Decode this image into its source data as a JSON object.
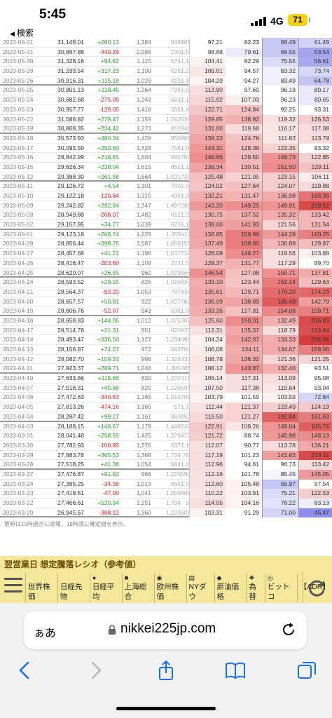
{
  "status_bar": {
    "time": "5:45",
    "back_label": "検索",
    "network": "4G",
    "battery": "71"
  },
  "rows": [
    {
      "date": "2023-06-01",
      "close": "31,148.01",
      "change": "+260.13",
      "up": "1,384",
      "down": "948",
      "unch": "805",
      "r1": "97.21",
      "r2": "82.23",
      "r3": "66.49",
      "r4": "61.49",
      "c1": "#ffffff",
      "c2": "#ffffff",
      "c3": "#c8c8f5",
      "c4": "#d2d2f8",
      "week": false
    },
    {
      "date": "2023-05-31",
      "close": "30,887.88",
      "change": "-440.28",
      "up": "2,586",
      "down": "230",
      "unch": "1,571",
      "r1": "98.88",
      "r2": "79.61",
      "r3": "66.55",
      "r4": "53.54",
      "c1": "#ffffff",
      "c2": "#ececfc",
      "c3": "#c8c8f5",
      "c4": "#a4a4ee",
      "week": false
    },
    {
      "date": "2023-05-30",
      "close": "31,328.16",
      "change": "+94.62",
      "up": "1,115",
      "down": "574",
      "unch": "1,197",
      "r1": "104.41",
      "r2": "82.29",
      "r3": "75.55",
      "r4": "56.61",
      "c1": "#fdf1f1",
      "c2": "#ffffff",
      "c3": "#dcdcfa",
      "c4": "#a9a9ef",
      "week": false
    },
    {
      "date": "2023-05-29",
      "close": "31,233.54",
      "change": "+317.23",
      "up": "1,109",
      "down": "626",
      "unch": "1,291",
      "r1": "109.01",
      "r2": "94.57",
      "r3": "83.32",
      "r4": "73.74",
      "c1": "#fbe6e6",
      "c2": "#ffffff",
      "c3": "#f0f0fd",
      "c4": "#d8d8f8",
      "week": false
    },
    {
      "date": "2023-05-26",
      "close": "30,916.31",
      "change": "+115.18",
      "up": "1,029",
      "down": "419",
      "unch": "1,171",
      "r1": "104.29",
      "r2": "94.27",
      "r3": "83.49",
      "r4": "64.78",
      "c1": "#fdf1f1",
      "c2": "#ffffff",
      "c3": "#f0f0fd",
      "c4": "#c4c4f4",
      "week": true
    },
    {
      "date": "2023-05-25",
      "close": "30,801.13",
      "change": "+118.45",
      "up": "1,264",
      "down": "726",
      "unch": "1,010",
      "r1": "113.90",
      "r2": "97.60",
      "r3": "96.19",
      "r4": "80.17",
      "c1": "#fadcdc",
      "c2": "#ffffff",
      "c3": "#ffffff",
      "c4": "#eaeafc",
      "week": false
    },
    {
      "date": "2023-05-24",
      "close": "30,682.68",
      "change": "-275.09",
      "up": "1,243",
      "down": "603",
      "unch": "1,134",
      "r1": "115.92",
      "r2": "107.03",
      "r3": "96.23",
      "r4": "80.65",
      "c1": "#f9d6d6",
      "c2": "#fcecec",
      "c3": "#ffffff",
      "c4": "#eaeafc",
      "week": false
    },
    {
      "date": "2023-05-23",
      "close": "30,957.77",
      "change": "-129.05",
      "up": "1,418",
      "down": "356",
      "unch": "1,420",
      "r1": "122.71",
      "r2": "124.84",
      "r3": "92.25",
      "r4": "93.31",
      "c1": "#f6c6c6",
      "c2": "#f5c2c2",
      "c3": "#ffffff",
      "c4": "#ffffff",
      "week": false
    },
    {
      "date": "2023-05-22",
      "close": "31,086.82",
      "change": "+278.47",
      "up": "1,159",
      "down": "1,242",
      "unch": "539",
      "r1": "129.85",
      "r2": "138.92",
      "r3": "119.32",
      "r4": "126.53",
      "c1": "#f3b5b5",
      "c2": "#f2b0b0",
      "c3": "#fae0e0",
      "c4": "#f7cccc",
      "week": false
    },
    {
      "date": "2023-05-19",
      "close": "30,808.35",
      "change": "+234.42",
      "up": "1,273",
      "down": "812",
      "unch": "945",
      "r1": "131.00",
      "r2": "119.68",
      "r3": "116.17",
      "r4": "117.08",
      "c1": "#f3b2b2",
      "c2": "#f9dcdc",
      "c3": "#fae4e4",
      "c4": "#fadcdc",
      "week": true
    },
    {
      "date": "2023-05-18",
      "close": "30,573.93",
      "change": "+480.34",
      "up": "1,426",
      "down": "956",
      "unch": "808",
      "r1": "138.22",
      "r2": "124.76",
      "r3": "111.83",
      "r4": "113.79",
      "c1": "#f0a5a5",
      "c2": "#f5c2c2",
      "c3": "#fbe6e6",
      "c4": "#fadcdc",
      "week": false
    },
    {
      "date": "2023-05-17",
      "close": "30,093.59",
      "change": "+250.60",
      "up": "1,428",
      "down": "758",
      "unch": "1,007",
      "r1": "143.31",
      "r2": "128.39",
      "r3": "122.35",
      "r4": "93.32",
      "c1": "#ee9898",
      "c2": "#f4bcbc",
      "c3": "#f7d0d0",
      "c4": "#ffffff",
      "week": false
    },
    {
      "date": "2023-05-16",
      "close": "29,842.99",
      "change": "+216.65",
      "up": "1,604",
      "down": "995",
      "unch": "767",
      "r1": "148.86",
      "r2": "129.50",
      "r3": "149.73",
      "r4": "122.85",
      "c1": "#ec8c8c",
      "c2": "#f4b8b8",
      "c3": "#ee9292",
      "c4": "#f7d0d0",
      "week": false
    },
    {
      "date": "2023-05-15",
      "close": "29,626.34",
      "change": "+238.04",
      "up": "1,615",
      "down": "855",
      "unch": "1,175",
      "r1": "139.34",
      "r2": "130.51",
      "r3": "151.50",
      "r4": "129.11",
      "c1": "#f0a2a2",
      "c2": "#f4b6b6",
      "c3": "#ec8c8c",
      "c4": "#f5c0c0",
      "week": false
    },
    {
      "date": "2023-05-12",
      "close": "29,388.30",
      "change": "+261.58",
      "up": "1,664",
      "down": "1,031",
      "unch": "737",
      "r1": "125.48",
      "r2": "121.05",
      "r3": "123.15",
      "r4": "106.11",
      "c1": "#f5c0c0",
      "c2": "#f8d2d2",
      "c3": "#f7cece",
      "c4": "#fcecec",
      "week": true
    },
    {
      "date": "2023-05-11",
      "close": "29,126.72",
      "change": "+4.54",
      "up": "1,301",
      "down": "740",
      "unch": "1,021",
      "r1": "124.02",
      "r2": "127.64",
      "r3": "124.07",
      "r4": "119.88",
      "c1": "#f6c4c4",
      "c2": "#f5c0c0",
      "c3": "#f7cccc",
      "c4": "#f9dada",
      "week": false
    },
    {
      "date": "2023-05-10",
      "close": "29,122.18",
      "change": "-120.64",
      "up": "1,315",
      "down": "436",
      "unch": "1,341",
      "r1": "132.21",
      "r2": "131.47",
      "r3": "136.98",
      "r4": "169.39",
      "c1": "#f2adad",
      "c2": "#f4b4b4",
      "c3": "#f2acac",
      "c4": "#e67373",
      "week": false
    },
    {
      "date": "2023-05-09",
      "close": "29,242.82",
      "change": "+292.94",
      "up": "1,347",
      "down": "1,497",
      "unch": "288",
      "r1": "143.20",
      "r2": "149.25",
      "r3": "149.91",
      "r4": "219.52",
      "c1": "#ee9898",
      "c2": "#ec8e8e",
      "c3": "#ee9292",
      "c4": "#d94a4a",
      "week": false
    },
    {
      "date": "2023-05-08",
      "close": "28,949.88",
      "change": "-208.07",
      "up": "1,482",
      "down": "612",
      "unch": "1,276",
      "r1": "130.75",
      "r2": "137.52",
      "r3": "135.32",
      "r4": "133.42",
      "c1": "#f3b4b4",
      "c2": "#f2acac",
      "c3": "#f2acac",
      "c4": "#f4b6b6",
      "week": false
    },
    {
      "date": "2023-05-02",
      "close": "29,157.95",
      "change": "+34.77",
      "up": "1,039",
      "down": "623",
      "unch": "1,115",
      "r1": "138.00",
      "r2": "141.93",
      "r3": "121.56",
      "r4": "131.54",
      "c1": "#f0a6a6",
      "c2": "#ef9e9e",
      "c3": "#f8d4d4",
      "c4": "#f4b6b6",
      "week": true
    },
    {
      "date": "2023-05-01",
      "close": "29,123.18",
      "change": "+266.74",
      "up": "1,229",
      "down": "1,355",
      "unch": "417",
      "r1": "138.85",
      "r2": "159.99",
      "r3": "144.28",
      "r4": "160.25",
      "c1": "#f0a4a4",
      "c2": "#e97c7c",
      "c3": "#ef9a9a",
      "c4": "#e88080",
      "week": false
    },
    {
      "date": "2023-04-28",
      "close": "28,856.44",
      "change": "+398.76",
      "up": "1,587",
      "down": "1,659",
      "unch": "155",
      "r1": "137.49",
      "r2": "159.80",
      "r3": "130.89",
      "r4": "129.97",
      "c1": "#f0a8a8",
      "c2": "#e97c7c",
      "c3": "#f4b6b6",
      "c4": "#f5bebe",
      "week": false
    },
    {
      "date": "2023-04-27",
      "close": "28,457.68",
      "change": "+41.21",
      "up": "1,196",
      "down": "1,037",
      "unch": "712",
      "r1": "128.09",
      "r2": "148.27",
      "r3": "119.56",
      "r4": "103.89",
      "c1": "#f4baba",
      "c2": "#ec8e8e",
      "c3": "#f9dcdc",
      "c4": "#fdf1f1",
      "week": false
    },
    {
      "date": "2023-04-26",
      "close": "28,416.47",
      "change": "-203.60",
      "up": "1,109",
      "down": "273",
      "unch": "1,516",
      "r1": "128.37",
      "r2": "131.77",
      "r3": "117.29",
      "r4": "89.70",
      "c1": "#f4baba",
      "c2": "#f3b2b2",
      "c3": "#fadede",
      "c4": "#ffffff",
      "week": false
    },
    {
      "date": "2023-04-25",
      "close": "28,620.07",
      "change": "+26.55",
      "up": "962",
      "down": "1,079",
      "unch": "666",
      "r1": "146.54",
      "r2": "127.08",
      "r3": "150.71",
      "r4": "137.81",
      "c1": "#ec9090",
      "c2": "#f5c0c0",
      "c3": "#ee9090",
      "c4": "#f2aaaa",
      "week": true
    },
    {
      "date": "2023-04-24",
      "close": "28,593.52",
      "change": "+29.15",
      "up": "826",
      "down": "1,016",
      "unch": "834",
      "r1": "133.10",
      "r2": "123.44",
      "r3": "162.14",
      "r4": "129.63",
      "c1": "#f2acac",
      "c2": "#f6c6c6",
      "c3": "#e87a7a",
      "c4": "#f5bebe",
      "week": false
    },
    {
      "date": "2023-04-21",
      "close": "28,564.37",
      "change": "-93.20",
      "up": "1,053",
      "down": "797",
      "unch": "834",
      "r1": "135.61",
      "r2": "129.71",
      "r3": "170.20",
      "r4": "174.23",
      "c1": "#f1a8a8",
      "c2": "#f4b8b8",
      "c3": "#e56c6c",
      "c4": "#e46868",
      "week": false
    },
    {
      "date": "2023-04-20",
      "close": "28,657.57",
      "change": "+50.81",
      "up": "922",
      "down": "1,027",
      "unch": "702",
      "r1": "136.09",
      "r2": "138.89",
      "r3": "185.48",
      "r4": "142.79",
      "c1": "#f1a8a8",
      "c2": "#f0a4a4",
      "c3": "#e05c5c",
      "c4": "#ef9c9c",
      "week": false
    },
    {
      "date": "2023-04-19",
      "close": "28,606.76",
      "change": "-52.07",
      "up": "943",
      "down": "638",
      "unch": "1,081",
      "r1": "133.26",
      "r2": "127.81",
      "r3": "154.08",
      "r4": "159.71",
      "c1": "#f2acac",
      "c2": "#f5c0c0",
      "c3": "#ec8888",
      "c4": "#e88080",
      "week": true
    },
    {
      "date": "2023-04-18",
      "close": "28,658.83",
      "change": "+144.05",
      "up": "1,012",
      "down": "1,371",
      "unch": "387",
      "r1": "125.60",
      "r2": "150.31",
      "r3": "132.49",
      "r4": "216.83",
      "c1": "#f5c0c0",
      "c2": "#ec8c8c",
      "c3": "#f3b0b0",
      "c4": "#d94c4c",
      "week": false
    },
    {
      "date": "2023-04-17",
      "close": "28,514.78",
      "change": "+21.31",
      "up": "951",
      "down": "920",
      "unch": "820",
      "r1": "112.31",
      "r2": "135.37",
      "r3": "118.79",
      "r4": "213.84",
      "c1": "#fae0e0",
      "c2": "#f2a8a8",
      "c3": "#f9dcdc",
      "c4": "#da5050",
      "week": false
    },
    {
      "date": "2023-04-14",
      "close": "28,493.47",
      "change": "+336.50",
      "up": "1,127",
      "down": "1,234",
      "unch": "496",
      "r1": "104.24",
      "r2": "142.07",
      "r3": "133.33",
      "r4": "236.56",
      "c1": "#fdf1f1",
      "c2": "#ef9e9e",
      "c3": "#f2acac",
      "c4": "#d43e3e",
      "week": false
    },
    {
      "date": "2023-04-13",
      "close": "28,156.97",
      "change": "+74.27",
      "up": "972",
      "down": "943",
      "unch": "760",
      "r1": "106.08",
      "r2": "134.11",
      "r3": "134.67",
      "r4": "158.06",
      "c1": "#fcecec",
      "c2": "#f2acac",
      "c3": "#f2aaaa",
      "c4": "#e88080",
      "week": false
    },
    {
      "date": "2023-04-12",
      "close": "28,082.70",
      "change": "+159.33",
      "up": "998",
      "down": "1,324",
      "unch": "433",
      "r1": "108.78",
      "r2": "136.32",
      "r3": "121.36",
      "r4": "121.25",
      "c1": "#fbe6e6",
      "c2": "#f1a8a8",
      "c3": "#f8d4d4",
      "c4": "#f8d4d4",
      "week": false
    },
    {
      "date": "2023-04-11",
      "close": "27,923.37",
      "change": "+289.71",
      "up": "1,046",
      "down": "1,385",
      "unch": "365",
      "r1": "108.12",
      "r2": "143.87",
      "r3": "132.40",
      "r4": "93.51",
      "c1": "#fbe6e6",
      "c2": "#ee9696",
      "c3": "#f3b0b0",
      "c4": "#ffffff",
      "week": true
    },
    {
      "date": "2023-04-10",
      "close": "27,633.66",
      "change": "+115.66",
      "up": "820",
      "down": "1,332",
      "unch": "415",
      "r1": "106.14",
      "r2": "117.31",
      "r3": "113.09",
      "r4": "95.08",
      "c1": "#fcecec",
      "c2": "#fadede",
      "c3": "#fadede",
      "c4": "#ffffff",
      "week": false
    },
    {
      "date": "2023-04-07",
      "close": "27,518.31",
      "change": "+45.68",
      "up": "820",
      "down": "1,126",
      "unch": "595",
      "r1": "107.50",
      "r2": "117.38",
      "r3": "110.64",
      "r4": "93.04",
      "c1": "#fbe8e8",
      "c2": "#fadede",
      "c3": "#fbe6e6",
      "c4": "#ffffff",
      "week": false
    },
    {
      "date": "2023-04-06",
      "close": "27,472.63",
      "change": "-340.63",
      "up": "1,165",
      "down": "1,016",
      "unch": "760",
      "r1": "103.79",
      "r2": "101.59",
      "r3": "103.59",
      "r4": "72.84",
      "c1": "#fdf1f1",
      "c2": "#ffffff",
      "c3": "#fdf1f1",
      "c4": "#d6d6f8",
      "week": false
    },
    {
      "date": "2023-04-05",
      "close": "27,813.26",
      "change": "-474.16",
      "up": "1,165",
      "down": "57",
      "unch": "1,763",
      "r1": "111.44",
      "r2": "121.37",
      "r3": "123.49",
      "r4": "124.19",
      "c1": "#fae2e2",
      "c2": "#f8d2d2",
      "c3": "#f7cece",
      "c4": "#f6caca",
      "week": false
    },
    {
      "date": "2023-04-04",
      "close": "28,287.42",
      "change": "+99.27",
      "up": "1,161",
      "down": "883",
      "unch": "853",
      "r1": "119.50",
      "r2": "121.27",
      "r3": "182.84",
      "r4": "161.63",
      "c1": "#f9d8d8",
      "c2": "#f8d2d2",
      "c3": "#e16060",
      "c4": "#e77c7c",
      "week": true
    },
    {
      "date": "2023-04-03",
      "close": "28,188.15",
      "change": "+146.67",
      "up": "1,179",
      "down": "1,448",
      "unch": "241",
      "r1": "122.91",
      "r2": "108.26",
      "r3": "149.04",
      "r4": "185.76",
      "c1": "#f6c8c8",
      "c2": "#fbe6e6",
      "c3": "#ee9494",
      "c4": "#e06060",
      "week": false
    },
    {
      "date": "2023-03-31",
      "close": "28,041.48",
      "change": "+258.55",
      "up": "1,425",
      "down": "1,279",
      "unch": "477",
      "r1": "121.72",
      "r2": "88.74",
      "r3": "145.98",
      "r4": "148.13",
      "c1": "#f7cccc",
      "c2": "#ffffff",
      "c3": "#ee9898",
      "c4": "#ec8e8e",
      "week": false
    },
    {
      "date": "2023-03-30",
      "close": "27,782.93",
      "change": "-100.85",
      "up": "1,276",
      "down": "637",
      "unch": "1,118",
      "r1": "112.07",
      "r2": "90.77",
      "r3": "113.78",
      "r4": "136.21",
      "c1": "#fae0e0",
      "c2": "#ffffff",
      "c3": "#fadcdc",
      "c4": "#f2aaaa",
      "week": false
    },
    {
      "date": "2023-03-29",
      "close": "27,883.78",
      "change": "+365.53",
      "up": "1,368",
      "down": "1,734",
      "unch": "78",
      "r1": "117.19",
      "r2": "101.23",
      "r3": "141.83",
      "r4": "219.11",
      "c1": "#f9dcdc",
      "c2": "#ffffff",
      "c3": "#ef9e9e",
      "c4": "#d94a4a",
      "week": false
    },
    {
      "date": "2023-03-28",
      "close": "27,518.25",
      "change": "+41.38",
      "up": "1,054",
      "down": "684",
      "unch": "1,046",
      "r1": "112.96",
      "r2": "94.61",
      "r3": "96.73",
      "r4": "113.42",
      "c1": "#fadede",
      "c2": "#ffffff",
      "c3": "#ffffff",
      "c4": "#fadcdc",
      "week": true
    },
    {
      "date": "2023-03-27",
      "close": "27,476.87",
      "change": "+91.62",
      "up": "966",
      "down": "1,229",
      "unch": "590",
      "r1": "112.16",
      "r2": "101.78",
      "r3": "85.45",
      "r4": "145.05",
      "c1": "#fae0e0",
      "c2": "#ffffff",
      "c3": "#f4f4fe",
      "c4": "#ee9a9a",
      "week": false
    },
    {
      "date": "2023-03-24",
      "close": "27,385.25",
      "change": "-34.36",
      "up": "1,019",
      "down": "656",
      "unch": "1,013",
      "r1": "112.60",
      "r2": "105.48",
      "r3": "65.97",
      "r4": "97.54",
      "c1": "#fae0e0",
      "c2": "#fcf0f0",
      "c3": "#c6c6f4",
      "c4": "#ffffff",
      "week": false
    },
    {
      "date": "2023-03-23",
      "close": "27,419.61",
      "change": "-47.00",
      "up": "1,041",
      "down": "1,059",
      "unch": "688",
      "r1": "110.22",
      "r2": "103.91",
      "r3": "75.21",
      "r4": "122.53",
      "c1": "#fbe4e4",
      "c2": "#fdf1f1",
      "c3": "#dcdcfa",
      "c4": "#f7cece",
      "week": false
    },
    {
      "date": "2023-03-22",
      "close": "27,466.61",
      "change": "+520.94",
      "up": "1,251",
      "down": "1,704",
      "unch": "0",
      "r1": "114.05",
      "r2": "104.16",
      "r3": "78.22",
      "r4": "83.13",
      "c1": "#fadcdc",
      "c2": "#fdf1f1",
      "c3": "#e2e2fb",
      "c4": "#eeeefd",
      "week": false
    },
    {
      "date": "2023-03-20",
      "close": "26,945.67",
      "change": "-388.12",
      "up": "1,360",
      "down": "1,223",
      "unch": "605",
      "r1": "103.31",
      "r2": "91.29",
      "r3": "71.00",
      "r4": "45.47",
      "c1": "#fdf2f2",
      "c2": "#ffffff",
      "c3": "#d4d4f8",
      "c4": "#8e8eea",
      "week": true
    }
  ],
  "note": "更新は15時過ぎに速報、18時頃に確定値を表示。",
  "band": {
    "title": "翌営業日 想定騰落レシオ（参考値）",
    "items": [
      {
        "label": "世界株価",
        "flag": ""
      },
      {
        "label": "日経先物",
        "flag": ""
      },
      {
        "label": "日経平均",
        "flag": "●"
      },
      {
        "label": "上海総合",
        "flag": "■"
      },
      {
        "label": "欧州株価",
        "flag": "◉"
      },
      {
        "label": "NYダウ",
        "flag": "▤"
      },
      {
        "label": "原油価格",
        "flag": "◆"
      },
      {
        "label": "為替",
        "flag": "❖"
      },
      {
        "label": "ビットコ",
        "flag": "◎"
      },
      {
        "label": "【ADR】",
        "flag": ""
      }
    ]
  },
  "browser": {
    "aa_label": "ぁあ",
    "url": "nikkei225jp.com"
  },
  "icons": [
    "back-icon",
    "forward-icon",
    "share-icon",
    "bookmarks-icon",
    "tabs-icon",
    "menu-icon",
    "refresh-icon",
    "lock-icon",
    "reload-icon"
  ],
  "colors": {
    "band_bg": "#f6e89a",
    "up_green": "#2a9d2a",
    "down_red": "#e02020",
    "link_blue": "#1a6ff0"
  }
}
